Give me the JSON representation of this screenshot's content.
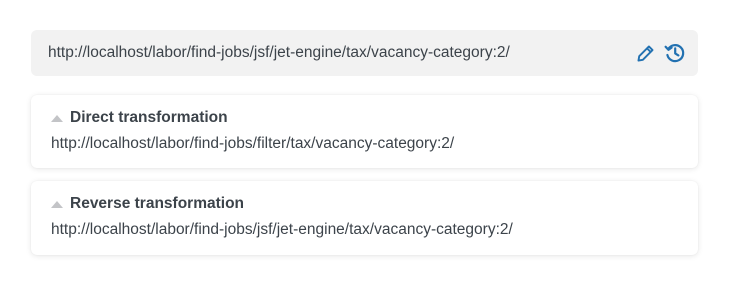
{
  "url_bar": {
    "value": "http://localhost/labor/find-jobs/jsf/jet-engine/tax/vacancy-category:2/",
    "edit_icon": "pencil-icon",
    "history_icon": "history-icon",
    "icon_color": "#2271b1"
  },
  "transforms": [
    {
      "title": "Direct transformation",
      "url": "http://localhost/labor/find-jobs/filter/tax/vacancy-category:2/",
      "toggle_icon": "triangle-up-icon"
    },
    {
      "title": "Reverse transformation",
      "url": "http://localhost/labor/find-jobs/jsf/jet-engine/tax/vacancy-category:2/",
      "toggle_icon": "triangle-up-icon"
    }
  ]
}
